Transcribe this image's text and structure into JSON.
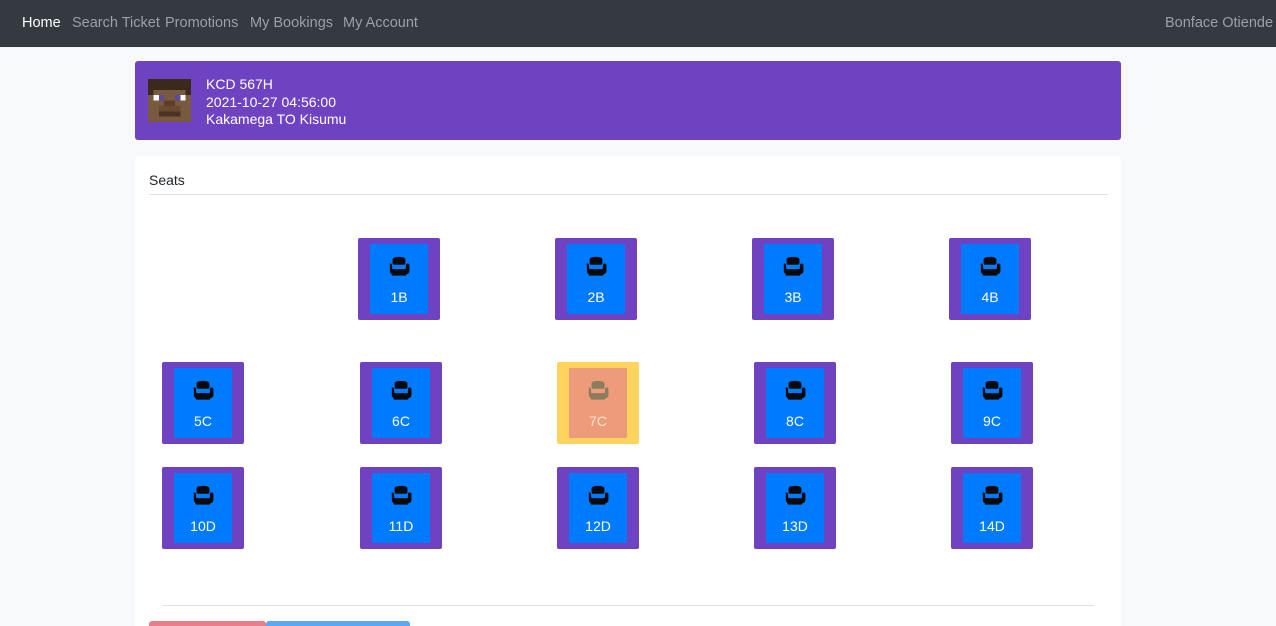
{
  "navbar": {
    "links": [
      {
        "label": "Home",
        "active": true
      },
      {
        "label": "Search Ticket",
        "active": false
      },
      {
        "label": "Promotions",
        "active": false
      },
      {
        "label": "My Bookings",
        "active": false
      },
      {
        "label": "My Account",
        "active": false
      }
    ],
    "user_name": "Bonface Otiende"
  },
  "trip": {
    "plate": "KCD 567H",
    "datetime": "2021-10-27 04:56:00",
    "route": "Kakamega TO Kisumu"
  },
  "seats_card": {
    "title": "Seats",
    "seats": [
      {
        "label": "1B",
        "status": "available"
      },
      {
        "label": "2B",
        "status": "available"
      },
      {
        "label": "3B",
        "status": "available"
      },
      {
        "label": "4B",
        "status": "available"
      },
      {
        "label": "5C",
        "status": "available"
      },
      {
        "label": "6C",
        "status": "available"
      },
      {
        "label": "7C",
        "status": "booked"
      },
      {
        "label": "8C",
        "status": "available"
      },
      {
        "label": "9C",
        "status": "available"
      },
      {
        "label": "10D",
        "status": "available"
      },
      {
        "label": "11D",
        "status": "available"
      },
      {
        "label": "12D",
        "status": "available"
      },
      {
        "label": "13D",
        "status": "available"
      },
      {
        "label": "14D",
        "status": "available"
      }
    ]
  },
  "colors": {
    "navbar_bg": "#343a40",
    "banner_bg": "#6f42c1",
    "seat_frame": "#6f42c1",
    "seat_fill": "#007bff",
    "booked_frame": "#ffd45e",
    "booked_fill": "#ee9b7b",
    "button_danger": "#e97d8a",
    "button_primary": "#5aa9f7"
  },
  "icons": {
    "seat": "armchair-icon",
    "avatar": "pixel-avatar"
  }
}
